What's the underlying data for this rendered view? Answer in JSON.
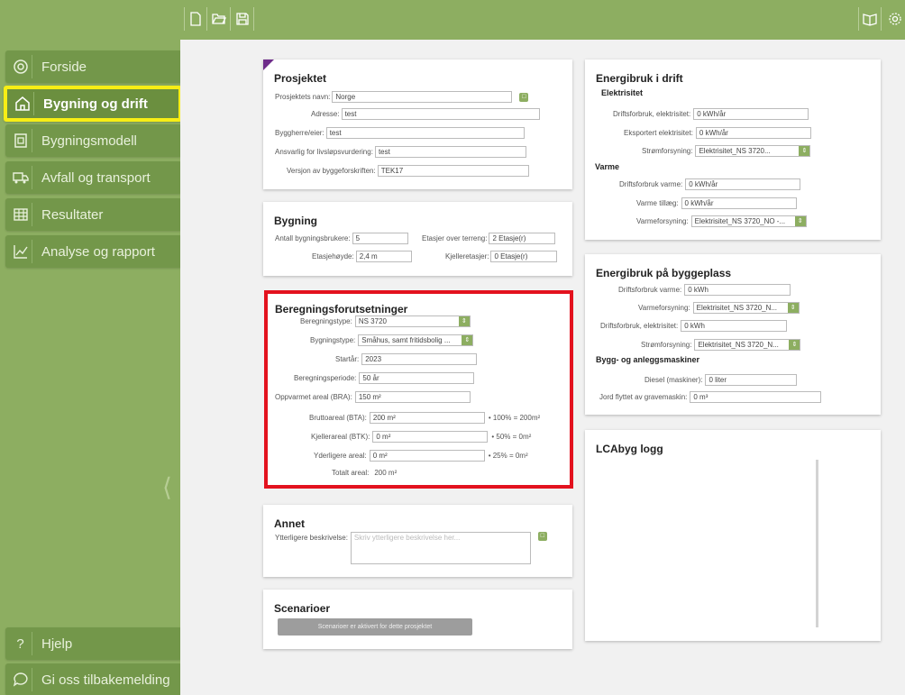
{
  "colors": {
    "accent": "#8dae61",
    "highlight": "#f7ee15",
    "red": "#e3121e"
  },
  "toolbar": {
    "new_icon": "file-icon",
    "open_icon": "folder-open-icon",
    "save_icon": "save-icon",
    "book_icon": "book-icon",
    "settings_icon": "gear-icon"
  },
  "sidebar": {
    "items": [
      {
        "label": "Forside",
        "icon": "home-circle-icon"
      },
      {
        "label": "Bygning og drift",
        "icon": "house-icon"
      },
      {
        "label": "Bygningsmodell",
        "icon": "building-model-icon"
      },
      {
        "label": "Avfall og transport",
        "icon": "truck-icon"
      },
      {
        "label": "Resultater",
        "icon": "table-icon"
      },
      {
        "label": "Analyse og rapport",
        "icon": "chart-icon"
      }
    ],
    "help": "Hjelp",
    "feedback": "Gi oss tilbakemelding",
    "help_icon": "?"
  },
  "prosjektet": {
    "title": "Prosjektet",
    "navn_label": "Prosjektets navn:",
    "navn": "Norge",
    "adresse_label": "Adresse:",
    "adresse": "test",
    "byggherre_label": "Byggherre/eier:",
    "byggherre": "test",
    "ansvarlig_label": "Ansvarlig for livsløpsvurdering:",
    "ansvarlig": "test",
    "versjon_label": "Versjon av byggeforskriften:",
    "versjon": "TEK17"
  },
  "bygning": {
    "title": "Bygning",
    "brukere_label": "Antall bygningsbrukere:",
    "brukere": "5",
    "etasjer_label": "Etasjer over terreng:",
    "etasjer": "2 Etasje(r)",
    "hoyde_label": "Etasjehøyde:",
    "hoyde": "2,4 m",
    "kjeller_label": "Kjelleretasjer:",
    "kjeller": "0 Etasje(r)"
  },
  "beregning": {
    "title": "Beregningsforutsetninger",
    "bertype_label": "Beregningstype:",
    "bertype": "NS 3720",
    "bygtype_label": "Bygningstype:",
    "bygtype": "Småhus, samt fritidsbolig ...",
    "start_label": "Startår:",
    "start": "2023",
    "periode_label": "Beregningsperiode:",
    "periode": "50 år",
    "bra_label": "Oppvarmet areal (BRA):",
    "bra": "150 m²",
    "bta_label": "Bruttoareal (BTA):",
    "bta": "200 m²",
    "bta_ext": "• 100% = 200m²",
    "btk_label": "Kjellerareal (BTK):",
    "btk": "0 m²",
    "btk_ext": "• 50% = 0m²",
    "ytre_label": "Yderligere areal:",
    "ytre": "0 m²",
    "ytre_ext": "• 25% = 0m²",
    "total_label": "Totalt areal:",
    "total": "200 m²"
  },
  "annet": {
    "title": "Annet",
    "beskr_label": "Ytterligere beskrivelse:",
    "beskr_placeholder": "Skriv ytterligere beskrivelse her..."
  },
  "scenarier": {
    "title": "Scenarioer",
    "button": "Scenarioer er aktivert for dette prosjektet"
  },
  "energi_drift": {
    "title": "Energibruk i drift",
    "el_title": "Elektrisitet",
    "drift_el_label": "Driftsforbruk, elektrisitet:",
    "drift_el": "0 kWh/år",
    "eksport_label": "Eksportert elektrisitet:",
    "eksport": "0 kWh/år",
    "strom_label": "Strømforsyning:",
    "strom": "Elektrisitet_NS 3720...",
    "varme_title": "Varme",
    "drift_varme_label": "Driftsforbruk varme:",
    "drift_varme": "0 kWh/år",
    "tillaeg_label": "Varme tillæg:",
    "tillaeg": "0 kWh/år",
    "varmefors_label": "Varmeforsyning:",
    "varmefors": "Elektrisitet_NS 3720_NO -..."
  },
  "energi_bygg": {
    "title": "Energibruk på byggeplass",
    "drift_varme_label": "Driftsforbruk varme:",
    "drift_varme": "0 kWh",
    "varmefors_label": "Varmeforsyning:",
    "varmefors": "Elektrisitet_NS 3720_N...",
    "drift_el_label": "Driftsforbruk, elektrisitet:",
    "drift_el": "0 kWh",
    "strom_label": "Strømforsyning:",
    "strom": "Elektrisitet_NS 3720_N...",
    "mask_title": "Bygg- og anleggsmaskiner",
    "diesel_label": "Diesel (maskiner):",
    "diesel": "0 liter",
    "jord_label": "Jord flyttet av gravemaskin:",
    "jord": "0 m³"
  },
  "logg": {
    "title": "LCAbyg logg"
  }
}
